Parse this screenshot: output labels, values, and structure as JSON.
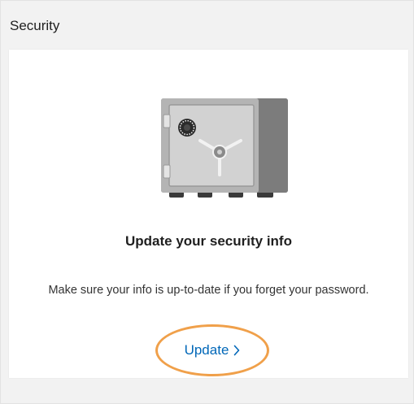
{
  "panel": {
    "title": "Security"
  },
  "card": {
    "heading": "Update your security info",
    "description": "Make sure your info is up-to-date if you forget your password.",
    "update_link": "Update"
  },
  "icons": {
    "illustration": "safe-icon",
    "link_chevron": "chevron-right-icon"
  },
  "colors": {
    "link": "#0067b8",
    "highlight_ring": "#f0a04a",
    "panel_bg": "#f2f2f2"
  }
}
